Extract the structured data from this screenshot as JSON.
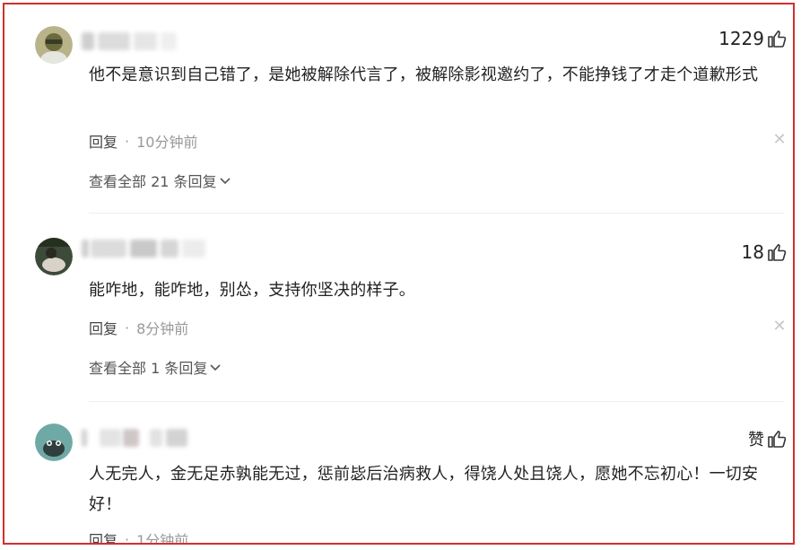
{
  "colors": {
    "frame_border": "#d32f2f",
    "text": "#222222",
    "meta": "#999999"
  },
  "comments": [
    {
      "likes": "1229",
      "text": "他不是意识到自己错了，是她被解除代言了，被解除影视邀约了，不能挣钱了才走个道歉形式",
      "reply_label": "回复",
      "separator": "·",
      "time": "10分钟前",
      "view_all": "查看全部 21 条回复"
    },
    {
      "likes": "18",
      "text": "能咋地，能咋地，别怂，支持你坚决的样子。",
      "reply_label": "回复",
      "separator": "·",
      "time": "8分钟前",
      "view_all": "查看全部 1 条回复"
    },
    {
      "likes": "赞",
      "text": "人无完人，金无足赤孰能无过，惩前毖后治病救人，得饶人处且饶人，愿她不忘初心！一切安好！",
      "reply_label": "回复",
      "separator": "·",
      "time": "1分钟前"
    }
  ],
  "icons": {
    "like": "thumbs-up-icon",
    "close": "close-icon",
    "expand": "chevron-down-icon"
  }
}
